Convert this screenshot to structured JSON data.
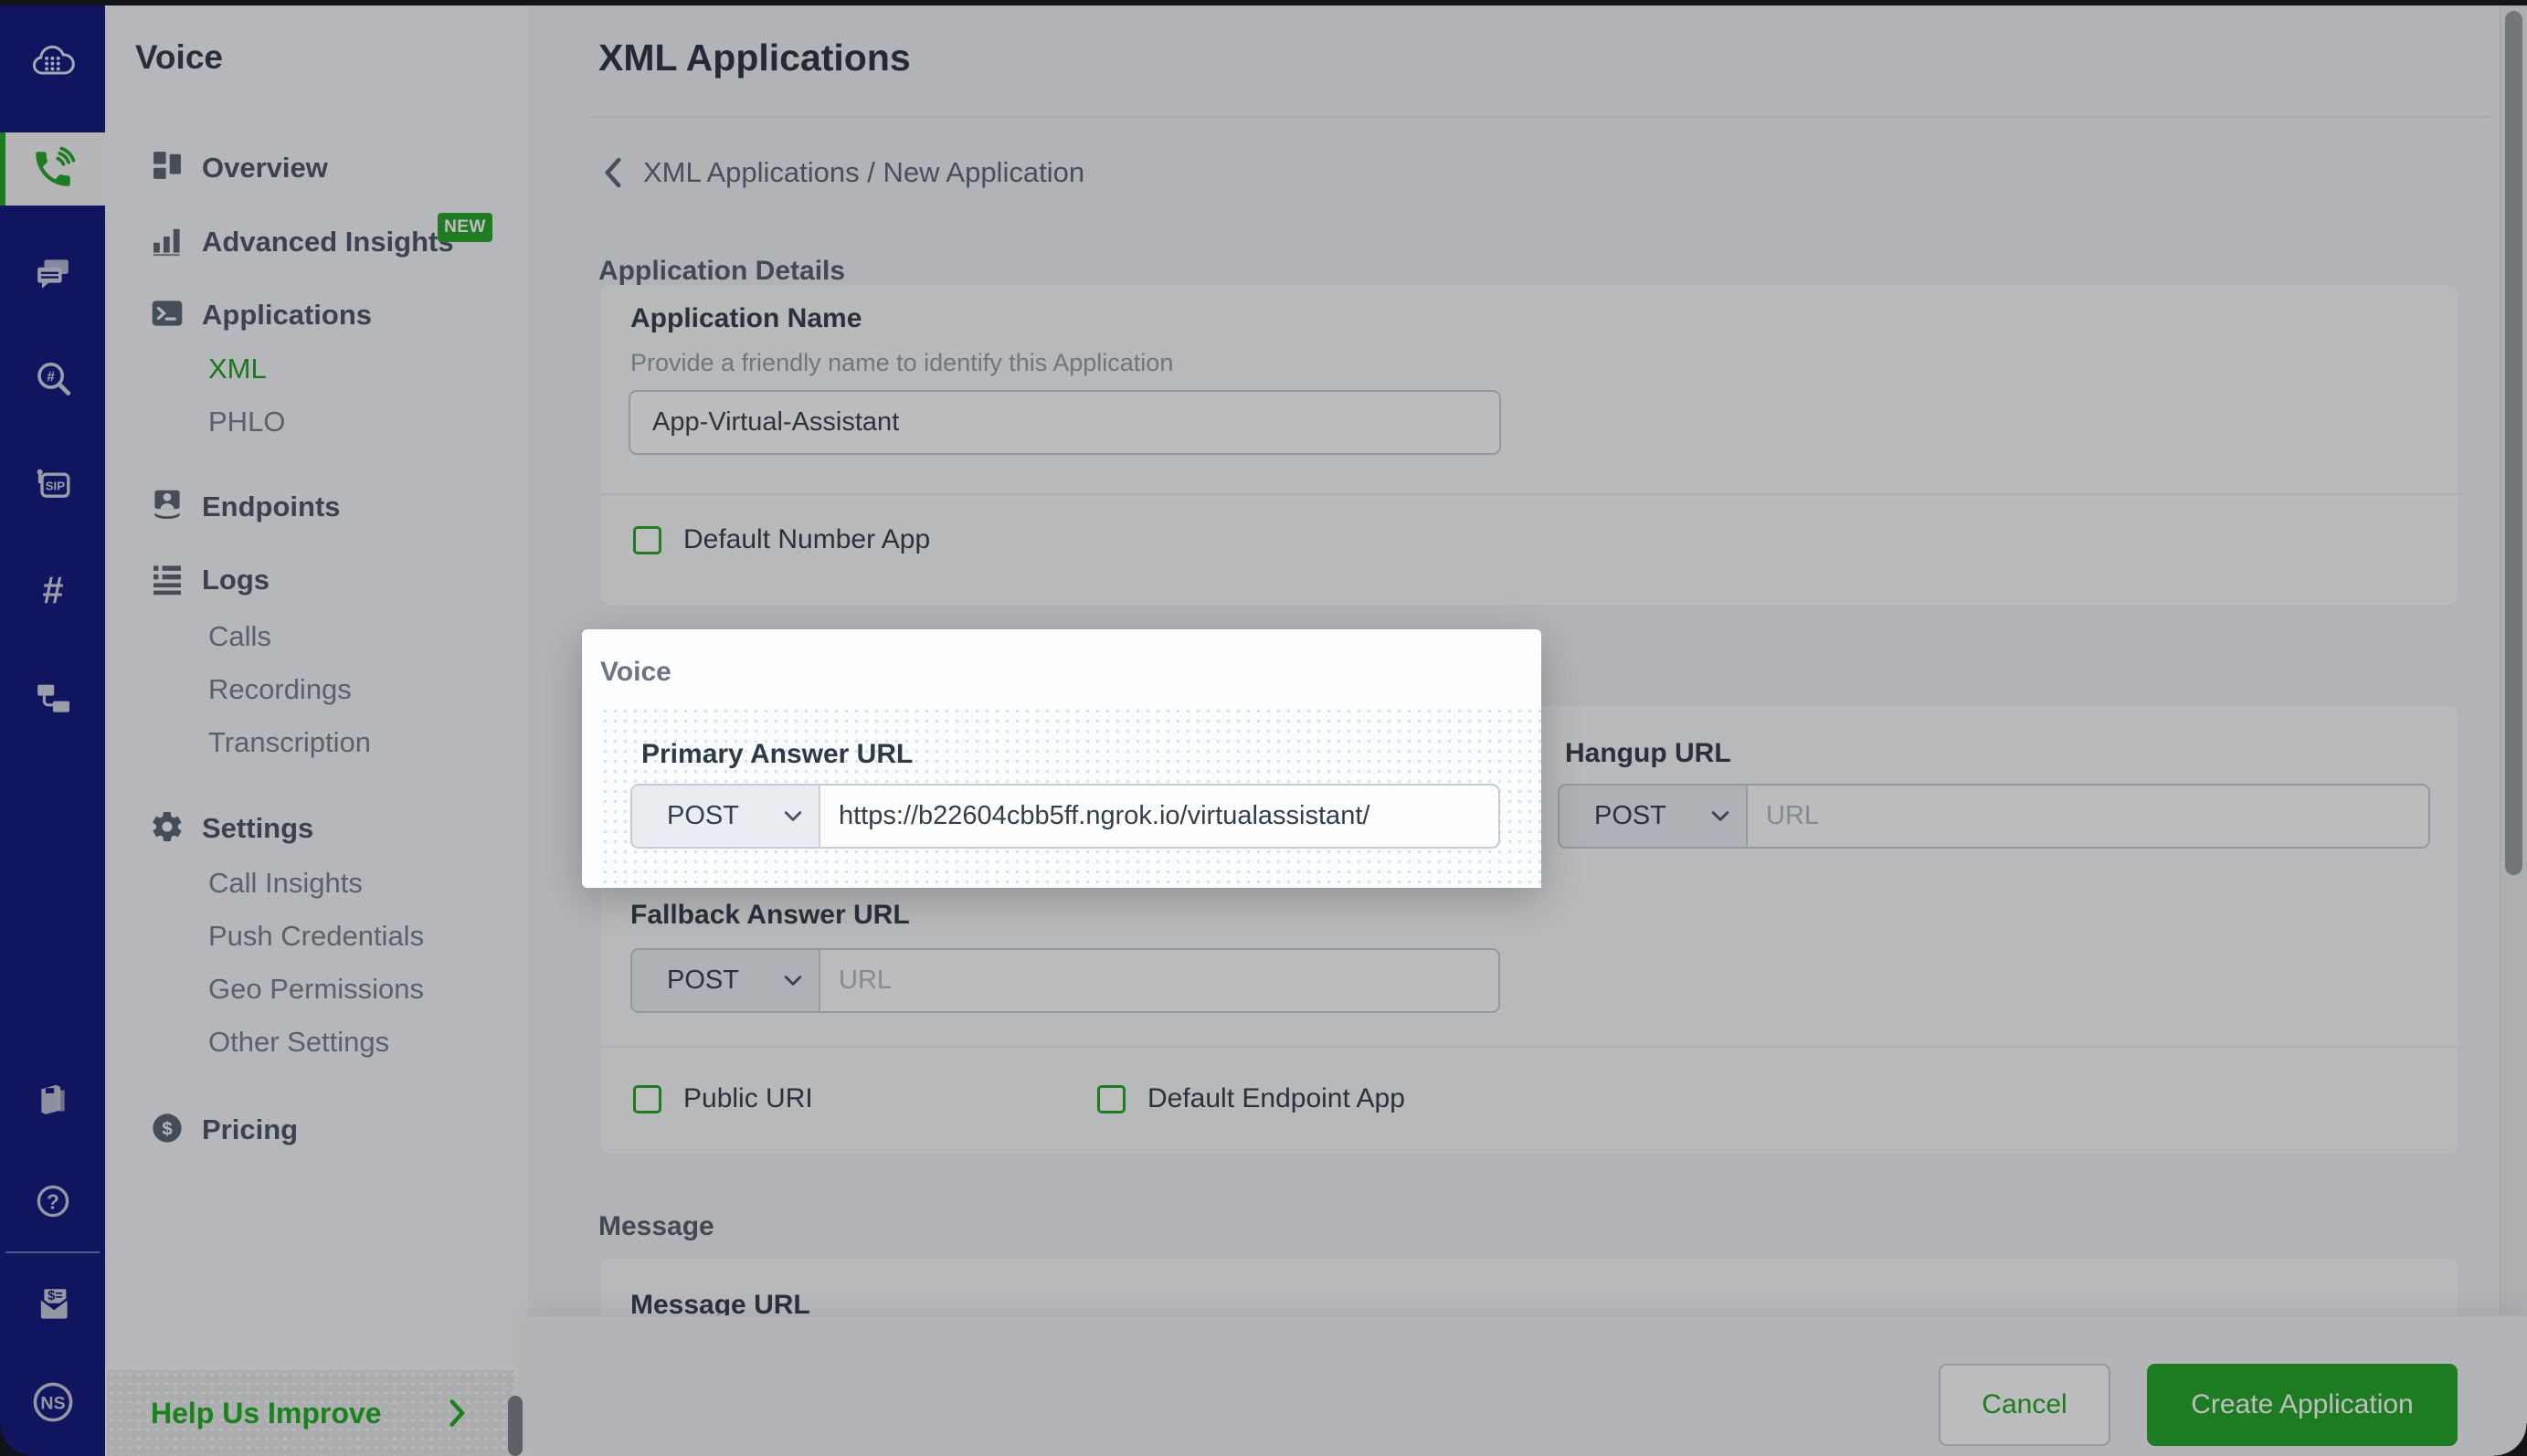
{
  "sidebar": {
    "title": "Voice",
    "items": [
      {
        "label": "Overview",
        "level": 1,
        "icon": "overview-icon"
      },
      {
        "label": "Advanced Insights",
        "level": 1,
        "icon": "insights-icon",
        "badge": "NEW"
      },
      {
        "label": "Applications",
        "level": 1,
        "icon": "applications-icon"
      },
      {
        "label": "XML",
        "level": 2,
        "active": true
      },
      {
        "label": "PHLO",
        "level": 2
      },
      {
        "label": "Endpoints",
        "level": 1,
        "icon": "endpoints-icon"
      },
      {
        "label": "Logs",
        "level": 1,
        "icon": "logs-icon"
      },
      {
        "label": "Calls",
        "level": 2
      },
      {
        "label": "Recordings",
        "level": 2
      },
      {
        "label": "Transcription",
        "level": 2
      },
      {
        "label": "Settings",
        "level": 1,
        "icon": "settings-icon"
      },
      {
        "label": "Call Insights",
        "level": 2
      },
      {
        "label": "Push Credentials",
        "level": 2
      },
      {
        "label": "Geo Permissions",
        "level": 2
      },
      {
        "label": "Other Settings",
        "level": 2
      },
      {
        "label": "Pricing",
        "level": 1,
        "icon": "pricing-icon"
      }
    ],
    "badge_new": "NEW",
    "help_label": "Help Us Improve"
  },
  "rail": {
    "icons": [
      "cloud-logo-icon",
      "voice-phone-icon",
      "messaging-icon",
      "number-search-icon",
      "sip-trunking-icon",
      "phone-numbers-icon",
      "phlo-icon",
      "docs-icon",
      "help-icon",
      "billing-icon"
    ],
    "sip_text": "SIP",
    "avatar_initials": "NS"
  },
  "header": {
    "title": "XML Applications",
    "breadcrumb": "XML Applications / New Application"
  },
  "sections": {
    "application_details": {
      "heading": "Application Details",
      "name_label": "Application Name",
      "name_help": "Provide a friendly name to identify this Application",
      "name_value": "App-Virtual-Assistant",
      "default_number_app_label": "Default Number App"
    },
    "voice": {
      "heading": "Voice",
      "primary_label": "Primary Answer URL",
      "primary_method": "POST",
      "primary_url": "https://b22604cbb5ff.ngrok.io/virtualassistant/",
      "hangup_label": "Hangup URL",
      "hangup_method": "POST",
      "fallback_label": "Fallback Answer URL",
      "fallback_method": "POST",
      "url_placeholder": "URL",
      "public_uri_label": "Public URI",
      "default_endpoint_app_label": "Default Endpoint App"
    },
    "message": {
      "heading": "Message",
      "url_label": "Message URL"
    }
  },
  "footer": {
    "cancel_label": "Cancel",
    "create_label": "Create Application"
  },
  "colors": {
    "accent_green": "#23a527",
    "rail_navy": "#12187d",
    "sidebar_bg": "#f5f6f8",
    "card_bg": "#f7f8fa",
    "dim_overlay": "rgba(13,14,18,0.27)"
  }
}
